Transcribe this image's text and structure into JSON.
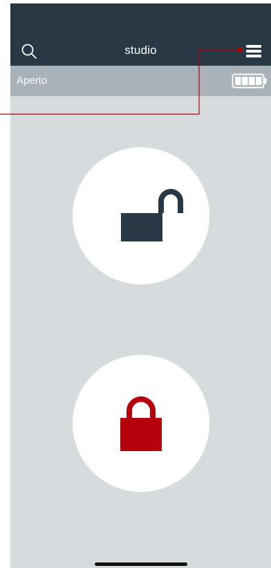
{
  "header": {
    "title": "studio",
    "search_icon": "search-icon",
    "menu_icon": "hamburger-menu-icon"
  },
  "status": {
    "label": "Aperto",
    "battery_icon": "battery-full-icon",
    "battery_level": 1.0
  },
  "actions": [
    {
      "name": "unlock",
      "icon": "unlocked-padlock-icon",
      "color": "#283845"
    },
    {
      "name": "lock",
      "icon": "locked-padlock-icon",
      "color": "#b5000e"
    }
  ],
  "colors": {
    "header_bg": "#283845",
    "status_bg": "#a9b2b9",
    "screen_bg": "#d6dbde",
    "callout": "#b5000e"
  }
}
